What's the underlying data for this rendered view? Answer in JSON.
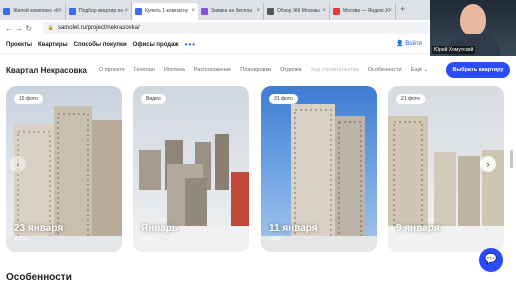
{
  "browser": {
    "tabs": [
      {
        "label": "Жилой комплекс «К",
        "favicon_color": "#3b6ef5"
      },
      {
        "label": "Подбор квартир по",
        "favicon_color": "#3b6ef5"
      },
      {
        "label": "Купить 1-комнатну",
        "favicon_color": "#3b6ef5"
      },
      {
        "label": "Заявка на беспла",
        "favicon_color": "#8a4fd8"
      },
      {
        "label": "Обзор ЖК Москвы",
        "favicon_color": "#555555"
      },
      {
        "label": "Москва — Яндекс.К",
        "favicon_color": "#e53935"
      }
    ],
    "active_tab_index": 2,
    "url": "samolet.ru/project/nekrasovka/",
    "new_tab_glyph": "+"
  },
  "site_nav": {
    "links": [
      "Проекты",
      "Квартиры",
      "Способы покупки",
      "Офисы продаж"
    ],
    "more": "•••",
    "login": "Войти"
  },
  "webcam": {
    "name": "Юрий Хомутский"
  },
  "subnav": {
    "title": "Квартал Некрасовка",
    "links": [
      "О проекте",
      "Генплан",
      "Ипотека",
      "Расположение",
      "Планировки",
      "Отделка",
      "Ход строительства",
      "Особенности"
    ],
    "dim_index": 6,
    "more": "Ещё ⌄",
    "cta": "Выбрать квартиру"
  },
  "gallery": {
    "cards": [
      {
        "badge": "15 фото",
        "date": "23 января",
        "year": "2023 г."
      },
      {
        "badge": "Видео",
        "date": "Январь",
        "year": "2023 г."
      },
      {
        "badge": "31 фото",
        "date": "11 января",
        "year": "2023 г."
      },
      {
        "badge": "21 фото",
        "date": "9 января",
        "year": "2023 г."
      }
    ],
    "next_arrow": "›",
    "prev_arrow": "‹"
  },
  "section_title": "Особенности",
  "colors": {
    "accent": "#2a4bff",
    "tabbar": "#dee1e6"
  },
  "icons": {
    "chat": "chat-icon",
    "lock": "lock-icon"
  }
}
